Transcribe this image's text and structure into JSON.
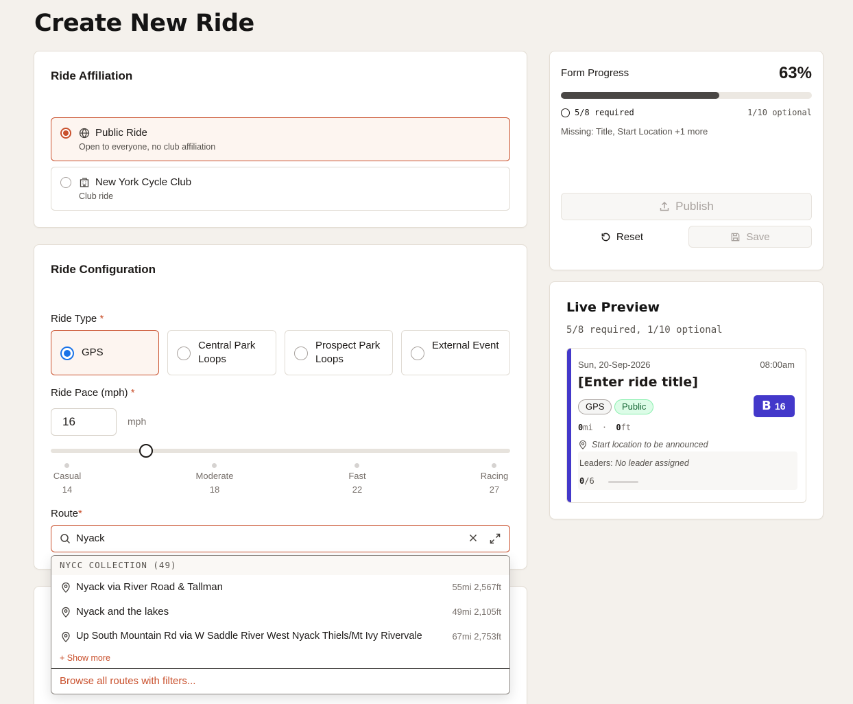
{
  "page_title": "Create New Ride",
  "affiliation": {
    "title": "Ride Affiliation",
    "options": [
      {
        "label": "Public Ride",
        "sub": "Open to everyone, no club affiliation",
        "icon": "globe-icon",
        "selected": true
      },
      {
        "label": "New York Cycle Club",
        "sub": "Club ride",
        "icon": "building-icon",
        "selected": false
      }
    ]
  },
  "config": {
    "title": "Ride Configuration",
    "ride_type_label": "Ride Type",
    "required_mark": "*",
    "ride_types": [
      {
        "label": "GPS",
        "selected": true
      },
      {
        "label": "Central Park Loops",
        "selected": false
      },
      {
        "label": "Prospect Park Loops",
        "selected": false
      },
      {
        "label": "External Event",
        "selected": false
      }
    ],
    "pace_label": "Ride Pace (mph)",
    "pace_value": "16",
    "pace_unit": "mph",
    "pace_slider": {
      "min": 13,
      "max": 27.5,
      "value": 16
    },
    "pace_levels": [
      {
        "name": "Casual",
        "value": "14"
      },
      {
        "name": "Moderate",
        "value": "18"
      },
      {
        "name": "Fast",
        "value": "22"
      },
      {
        "name": "Racing",
        "value": "27"
      }
    ],
    "route_label": "Route",
    "route_value": "Nyack"
  },
  "route_dropdown": {
    "header": "NYCC COLLECTION (49)",
    "items": [
      {
        "name": "Nyack via River Road & Tallman",
        "meta": "55mi 2,567ft"
      },
      {
        "name": "Nyack and the lakes",
        "meta": "49mi 2,105ft"
      },
      {
        "name": "Up South Mountain Rd via W Saddle River West Nyack Thiels/Mt Ivy Rivervale",
        "meta": "67mi 2,753ft"
      }
    ],
    "show_more": "+ Show more",
    "browse": "Browse all routes with filters..."
  },
  "progress": {
    "label": "Form Progress",
    "percent": "63%",
    "fraction": 0.63,
    "required": "5/8 required",
    "optional": "1/10 optional",
    "missing": "Missing: Title, Start Location +1 more",
    "publish": "Publish",
    "reset": "Reset",
    "save": "Save"
  },
  "preview": {
    "title": "Live Preview",
    "sub": "5/8 required, 1/10 optional",
    "date": "Sun, 20-Sep-2026",
    "time": "08:00am",
    "ride_title": "[Enter ride title]",
    "badge_type": "GPS",
    "badge_aff": "Public",
    "pace_letter": "B",
    "pace_num": "16",
    "distance": "0",
    "distance_unit": "mi",
    "sep": "·",
    "elevation": "0",
    "elevation_unit": "ft",
    "location": "Start location to be announced",
    "leaders_label": "Leaders:",
    "leaders_value": "No leader assigned",
    "signup_count": "0",
    "signup_total": "/6",
    "accent": "#4338ca"
  },
  "colors": {
    "accent": "#c9502c",
    "radio_blue": "#1a73e8",
    "pace_badge": "#4338ca"
  }
}
